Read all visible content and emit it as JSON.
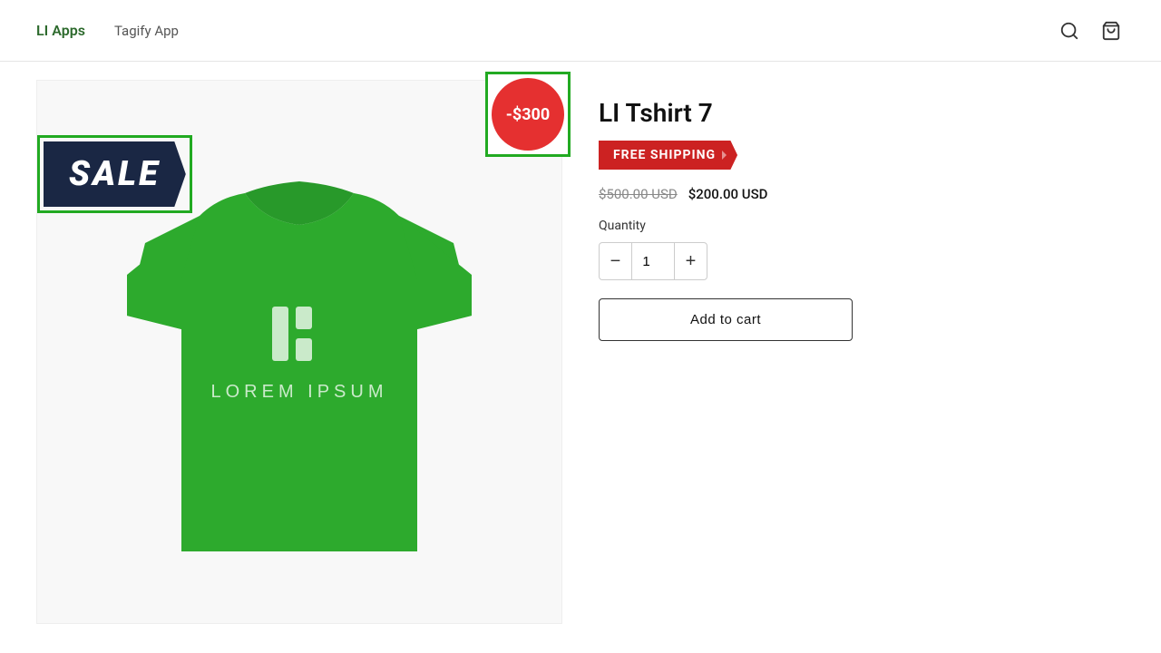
{
  "header": {
    "brand_label": "LI Apps",
    "nav_link": "Tagify App"
  },
  "discount_badge": {
    "text": "-$300"
  },
  "sale_badge": {
    "text": "SALE"
  },
  "product": {
    "title": "LI Tshirt 7",
    "free_shipping_label": "FREE SHIPPING",
    "original_price": "$500.00 USD",
    "sale_price": "$200.00 USD",
    "quantity_label": "Quantity",
    "quantity_value": "1",
    "qty_decrease_label": "−",
    "qty_increase_label": "+",
    "add_to_cart_label": "Add to cart"
  },
  "colors": {
    "brand_green": "#2d6a2d",
    "sale_dark": "#1a2744",
    "badge_red": "#cc2222",
    "discount_red": "#e53030",
    "highlight_green": "#22aa22",
    "tshirt_green": "#2daa2d"
  }
}
